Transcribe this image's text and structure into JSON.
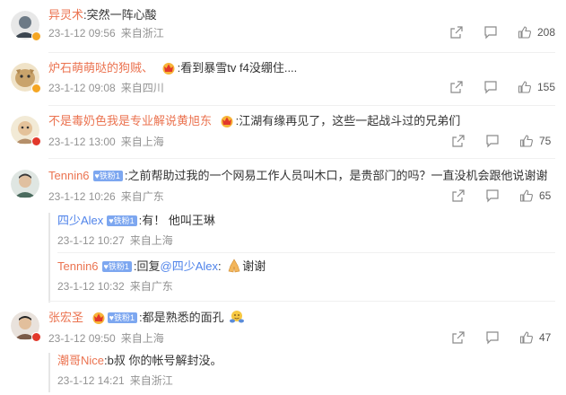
{
  "comments": [
    {
      "user": "异灵术",
      "text": "突然一阵心酸",
      "time": "23-1-12 09:56",
      "location": "来自浙江",
      "likes": "208",
      "avatar_color": "#6d7a86",
      "vbadge_color": "#f5a623"
    },
    {
      "user": "炉石萌萌哒的狗贼、",
      "text": "看到暴雪tv f4没绷住....",
      "time": "23-1-12 09:08",
      "location": "来自四川",
      "likes": "155",
      "avatar_color": "#c9a36b",
      "vbadge_color": "#f5a623"
    },
    {
      "user": "不是毒奶色我是专业解说黄旭东",
      "text": "江湖有缘再见了，这些一起战斗过的兄弟们",
      "time": "23-1-12 13:00",
      "location": "来自上海",
      "likes": "75",
      "avatar_color": "#b58f6a",
      "vbadge_color": "#e2382b"
    },
    {
      "user": "Tennin6",
      "fan_badge": "铁粉1",
      "text": "之前帮助过我的一个网易工作人员叫木口，是贵部门的吗？一直没机会跟他说谢谢",
      "time": "23-1-12 10:26",
      "location": "来自广东",
      "likes": "65",
      "avatar_color": "#4a6b5e",
      "replies": [
        {
          "user": "四少Alex",
          "fan_badge": "铁粉1",
          "text": "有！ 他叫王琳",
          "time": "23-1-12 10:27",
          "location": "来自上海"
        },
        {
          "user": "Tennin6",
          "fan_badge": "铁粉1",
          "text_prefix": "回复",
          "mention": "@四少Alex",
          "text": "谢谢",
          "time": "23-1-12 10:32",
          "location": "来自广东"
        }
      ]
    },
    {
      "user": "张宏圣",
      "fan_badge": "铁粉1",
      "text": "都是熟悉的面孔",
      "time": "23-1-12 09:50",
      "location": "来自上海",
      "likes": "47",
      "avatar_color": "#7a5a48",
      "vbadge_color": "#e2382b",
      "replies": [
        {
          "user": "潮哥Nice",
          "text": "b叔 你的帐号解封没。",
          "time": "23-1-12 14:21",
          "location": "来自浙江"
        }
      ]
    }
  ],
  "colors": {
    "username": "#eb7350",
    "meta": "#939393",
    "mention": "#4f83ea"
  }
}
